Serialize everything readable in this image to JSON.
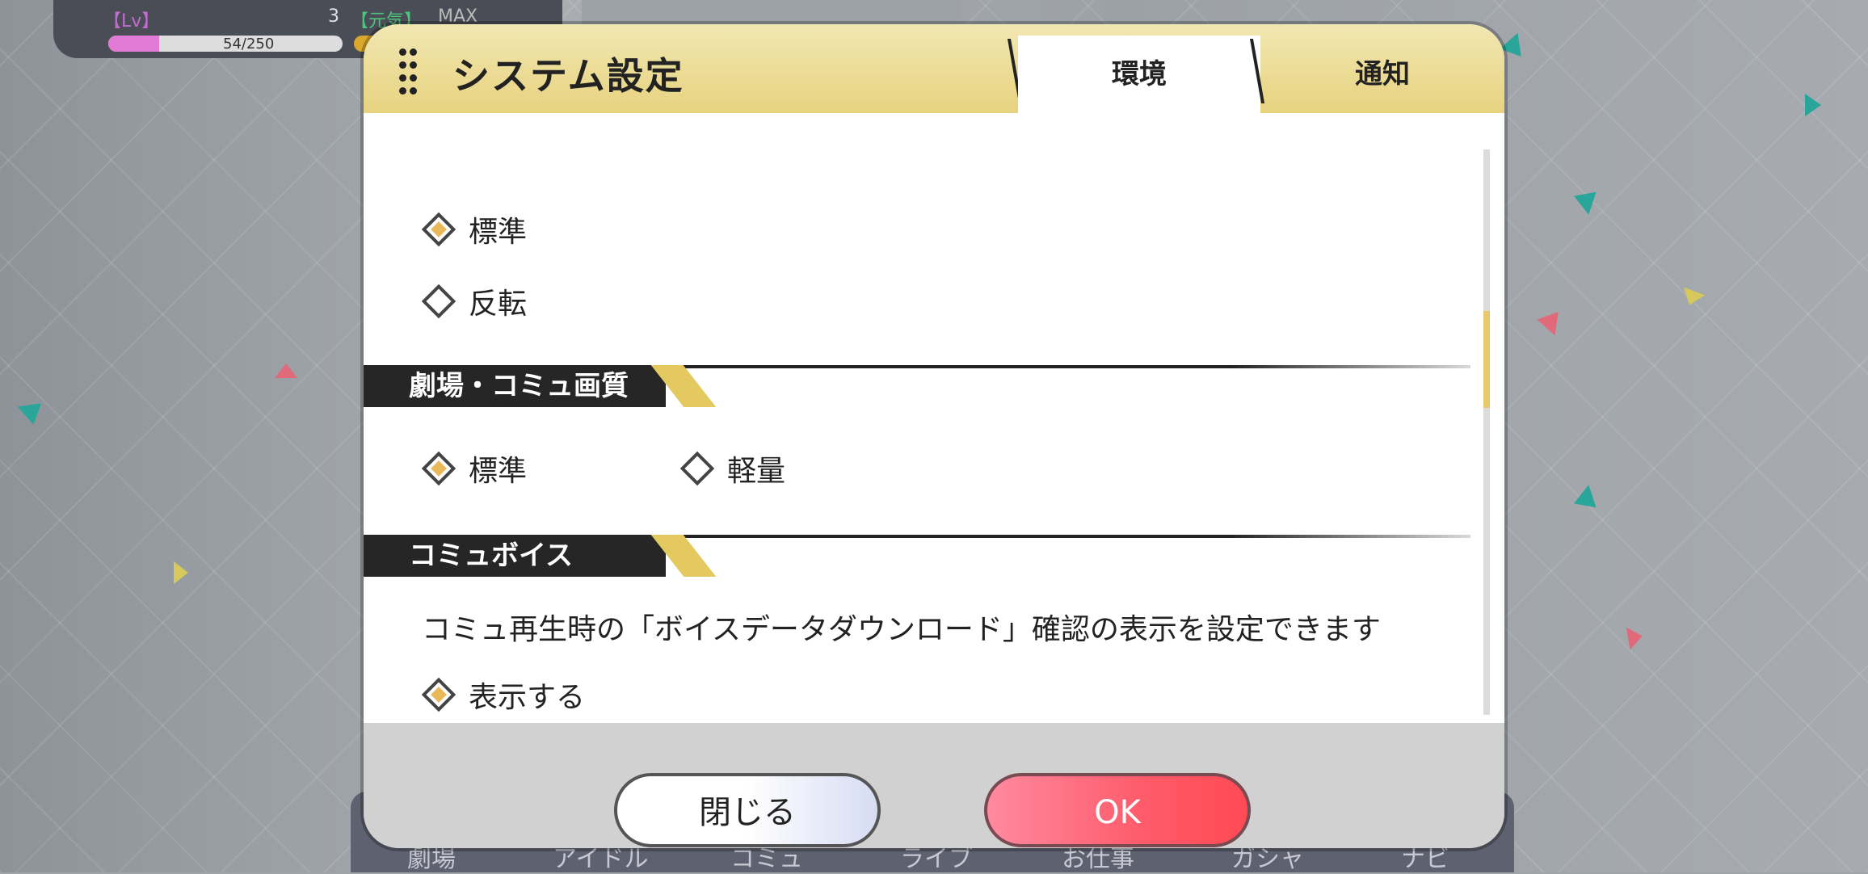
{
  "hud": {
    "lv_label": "【Lv】",
    "lv_value": "3",
    "genki_label": "【元気】",
    "max_label": "MAX",
    "exp_text": "54/250",
    "exp_fraction": 0.216
  },
  "dialog": {
    "title": "システム設定",
    "tabs": [
      {
        "label": "環境",
        "active": true
      },
      {
        "label": "通知",
        "active": false
      }
    ],
    "top_options": [
      {
        "label": "標準",
        "selected": true
      },
      {
        "label": "反転",
        "selected": false
      }
    ],
    "sections": [
      {
        "title": "劇場・コミュ画質",
        "options": [
          {
            "label": "標準",
            "selected": true
          },
          {
            "label": "軽量",
            "selected": false
          }
        ]
      },
      {
        "title": "コミュボイス",
        "description": "コミュ再生時の「ボイスデータダウンロード」確認の表示を設定できます",
        "options": [
          {
            "label": "表示する",
            "selected": true
          }
        ]
      }
    ],
    "buttons": {
      "close_label": "閉じる",
      "ok_label": "OK"
    }
  },
  "bottom_nav": [
    "劇場",
    "アイドル",
    "コミュ",
    "ライブ",
    "お仕事",
    "ガシャ",
    "ナビ"
  ]
}
